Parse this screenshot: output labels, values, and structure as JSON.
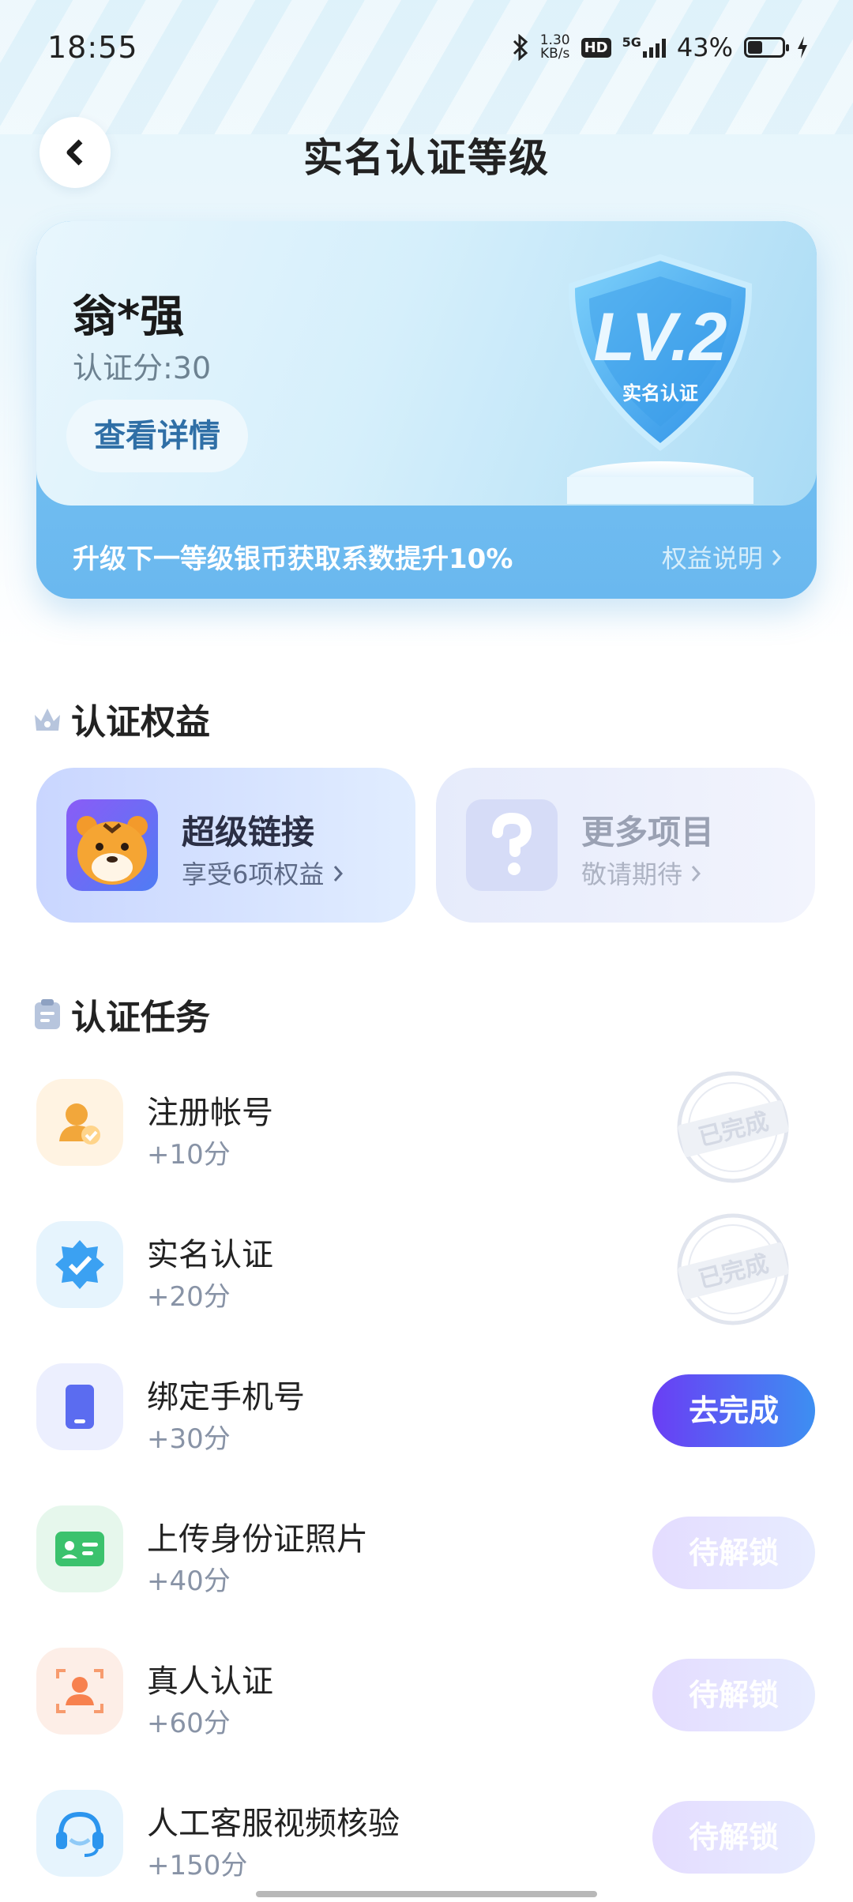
{
  "status_bar": {
    "time": "18:55",
    "net_speed_top": "1.30",
    "net_speed_unit": "KB/s",
    "hd": "HD",
    "net_type": "5G",
    "battery_percent": "43%",
    "battery_level": 0.43
  },
  "header": {
    "title": "实名认证等级"
  },
  "level_card": {
    "user_name": "翁*强",
    "score": "认证分:30",
    "detail_button": "查看详情",
    "badge_level": "LV.2",
    "badge_label": "实名认证",
    "upgrade_tip": "升级下一等级银币获取系数提升10%",
    "benefit_link": "权益说明"
  },
  "benefits": {
    "title": "认证权益",
    "items": [
      {
        "title": "超级链接",
        "subtitle": "享受6项权益"
      },
      {
        "title": "更多项目",
        "subtitle": "敬请期待"
      }
    ]
  },
  "tasks": {
    "title": "认证任务",
    "completed_stamp": "已完成",
    "items": [
      {
        "name": "注册帐号",
        "points": "+10分",
        "status": "已完成"
      },
      {
        "name": "实名认证",
        "points": "+20分",
        "status": "已完成"
      },
      {
        "name": "绑定手机号",
        "points": "+30分",
        "status": "去完成"
      },
      {
        "name": "上传身份证照片",
        "points": "+40分",
        "status": "待解锁"
      },
      {
        "name": "真人认证",
        "points": "+60分",
        "status": "待解锁"
      },
      {
        "name": "人工客服视频核验",
        "points": "+150分",
        "status": "待解锁"
      }
    ]
  },
  "colors": {
    "accent_purple": "#6a3ef4",
    "accent_blue": "#3d8ff2",
    "card_blue": "#6ab8ef"
  }
}
